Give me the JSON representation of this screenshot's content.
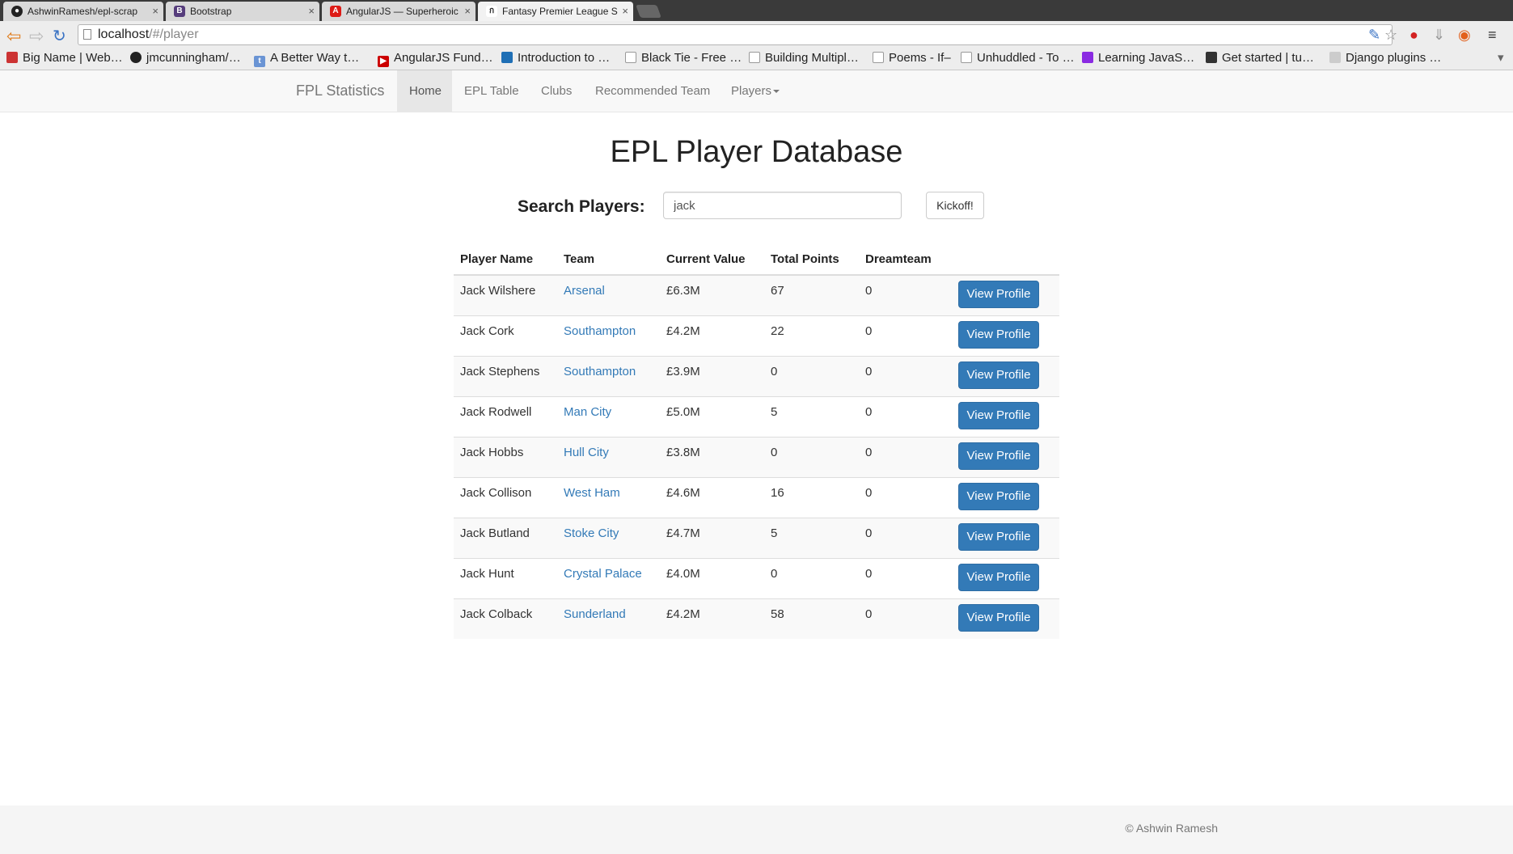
{
  "browser": {
    "tabs": [
      {
        "title": "AshwinRamesh/epl-scrap",
        "icon": "github-icon"
      },
      {
        "title": "Bootstrap",
        "icon": "bootstrap-icon"
      },
      {
        "title": "AngularJS — Superheroic",
        "icon": "angular-icon"
      },
      {
        "title": "Fantasy Premier League S",
        "icon": "fpl-icon",
        "active": true
      }
    ],
    "url_host": "localhost",
    "url_path": "/#/player",
    "bookmarks": [
      "Big Name | Web…",
      "jmcunningham/…",
      "A Better Way t…",
      "AngularJS Fund…",
      "Introduction to …",
      "Black Tie - Free …",
      "Building Multipl…",
      "Poems - If–",
      "Unhuddled - To …",
      "Learning JavaS…",
      "Get started | tu…",
      "Django plugins …"
    ]
  },
  "navbar": {
    "brand": "FPL Statistics",
    "items": [
      {
        "label": "Home",
        "active": true
      },
      {
        "label": "EPL Table"
      },
      {
        "label": "Clubs"
      },
      {
        "label": "Recommended Team"
      },
      {
        "label": "Players"
      }
    ]
  },
  "main": {
    "title": "EPL Player Database",
    "search": {
      "label": "Search Players:",
      "value": "jack",
      "button": "Kickoff!"
    },
    "table": {
      "headers": [
        "Player Name",
        "Team",
        "Current Value",
        "Total Points",
        "Dreamteam"
      ],
      "action_label": "View Profile",
      "rows": [
        {
          "name": "Jack Wilshere",
          "team": "Arsenal",
          "value": "£6.3M",
          "points": "67",
          "dreamteam": "0"
        },
        {
          "name": "Jack Cork",
          "team": "Southampton",
          "value": "£4.2M",
          "points": "22",
          "dreamteam": "0"
        },
        {
          "name": "Jack Stephens",
          "team": "Southampton",
          "value": "£3.9M",
          "points": "0",
          "dreamteam": "0"
        },
        {
          "name": "Jack Rodwell",
          "team": "Man City",
          "value": "£5.0M",
          "points": "5",
          "dreamteam": "0"
        },
        {
          "name": "Jack Hobbs",
          "team": "Hull City",
          "value": "£3.8M",
          "points": "0",
          "dreamteam": "0"
        },
        {
          "name": "Jack Collison",
          "team": "West Ham",
          "value": "£4.6M",
          "points": "16",
          "dreamteam": "0"
        },
        {
          "name": "Jack Butland",
          "team": "Stoke City",
          "value": "£4.7M",
          "points": "5",
          "dreamteam": "0"
        },
        {
          "name": "Jack Hunt",
          "team": "Crystal Palace",
          "value": "£4.0M",
          "points": "0",
          "dreamteam": "0"
        },
        {
          "name": "Jack Colback",
          "team": "Sunderland",
          "value": "£4.2M",
          "points": "58",
          "dreamteam": "0"
        }
      ]
    }
  },
  "footer": {
    "copyright": "© Ashwin Ramesh"
  },
  "colors": {
    "primary": "#337ab7",
    "link": "#337ab7",
    "navbar_bg": "#f8f8f8"
  }
}
